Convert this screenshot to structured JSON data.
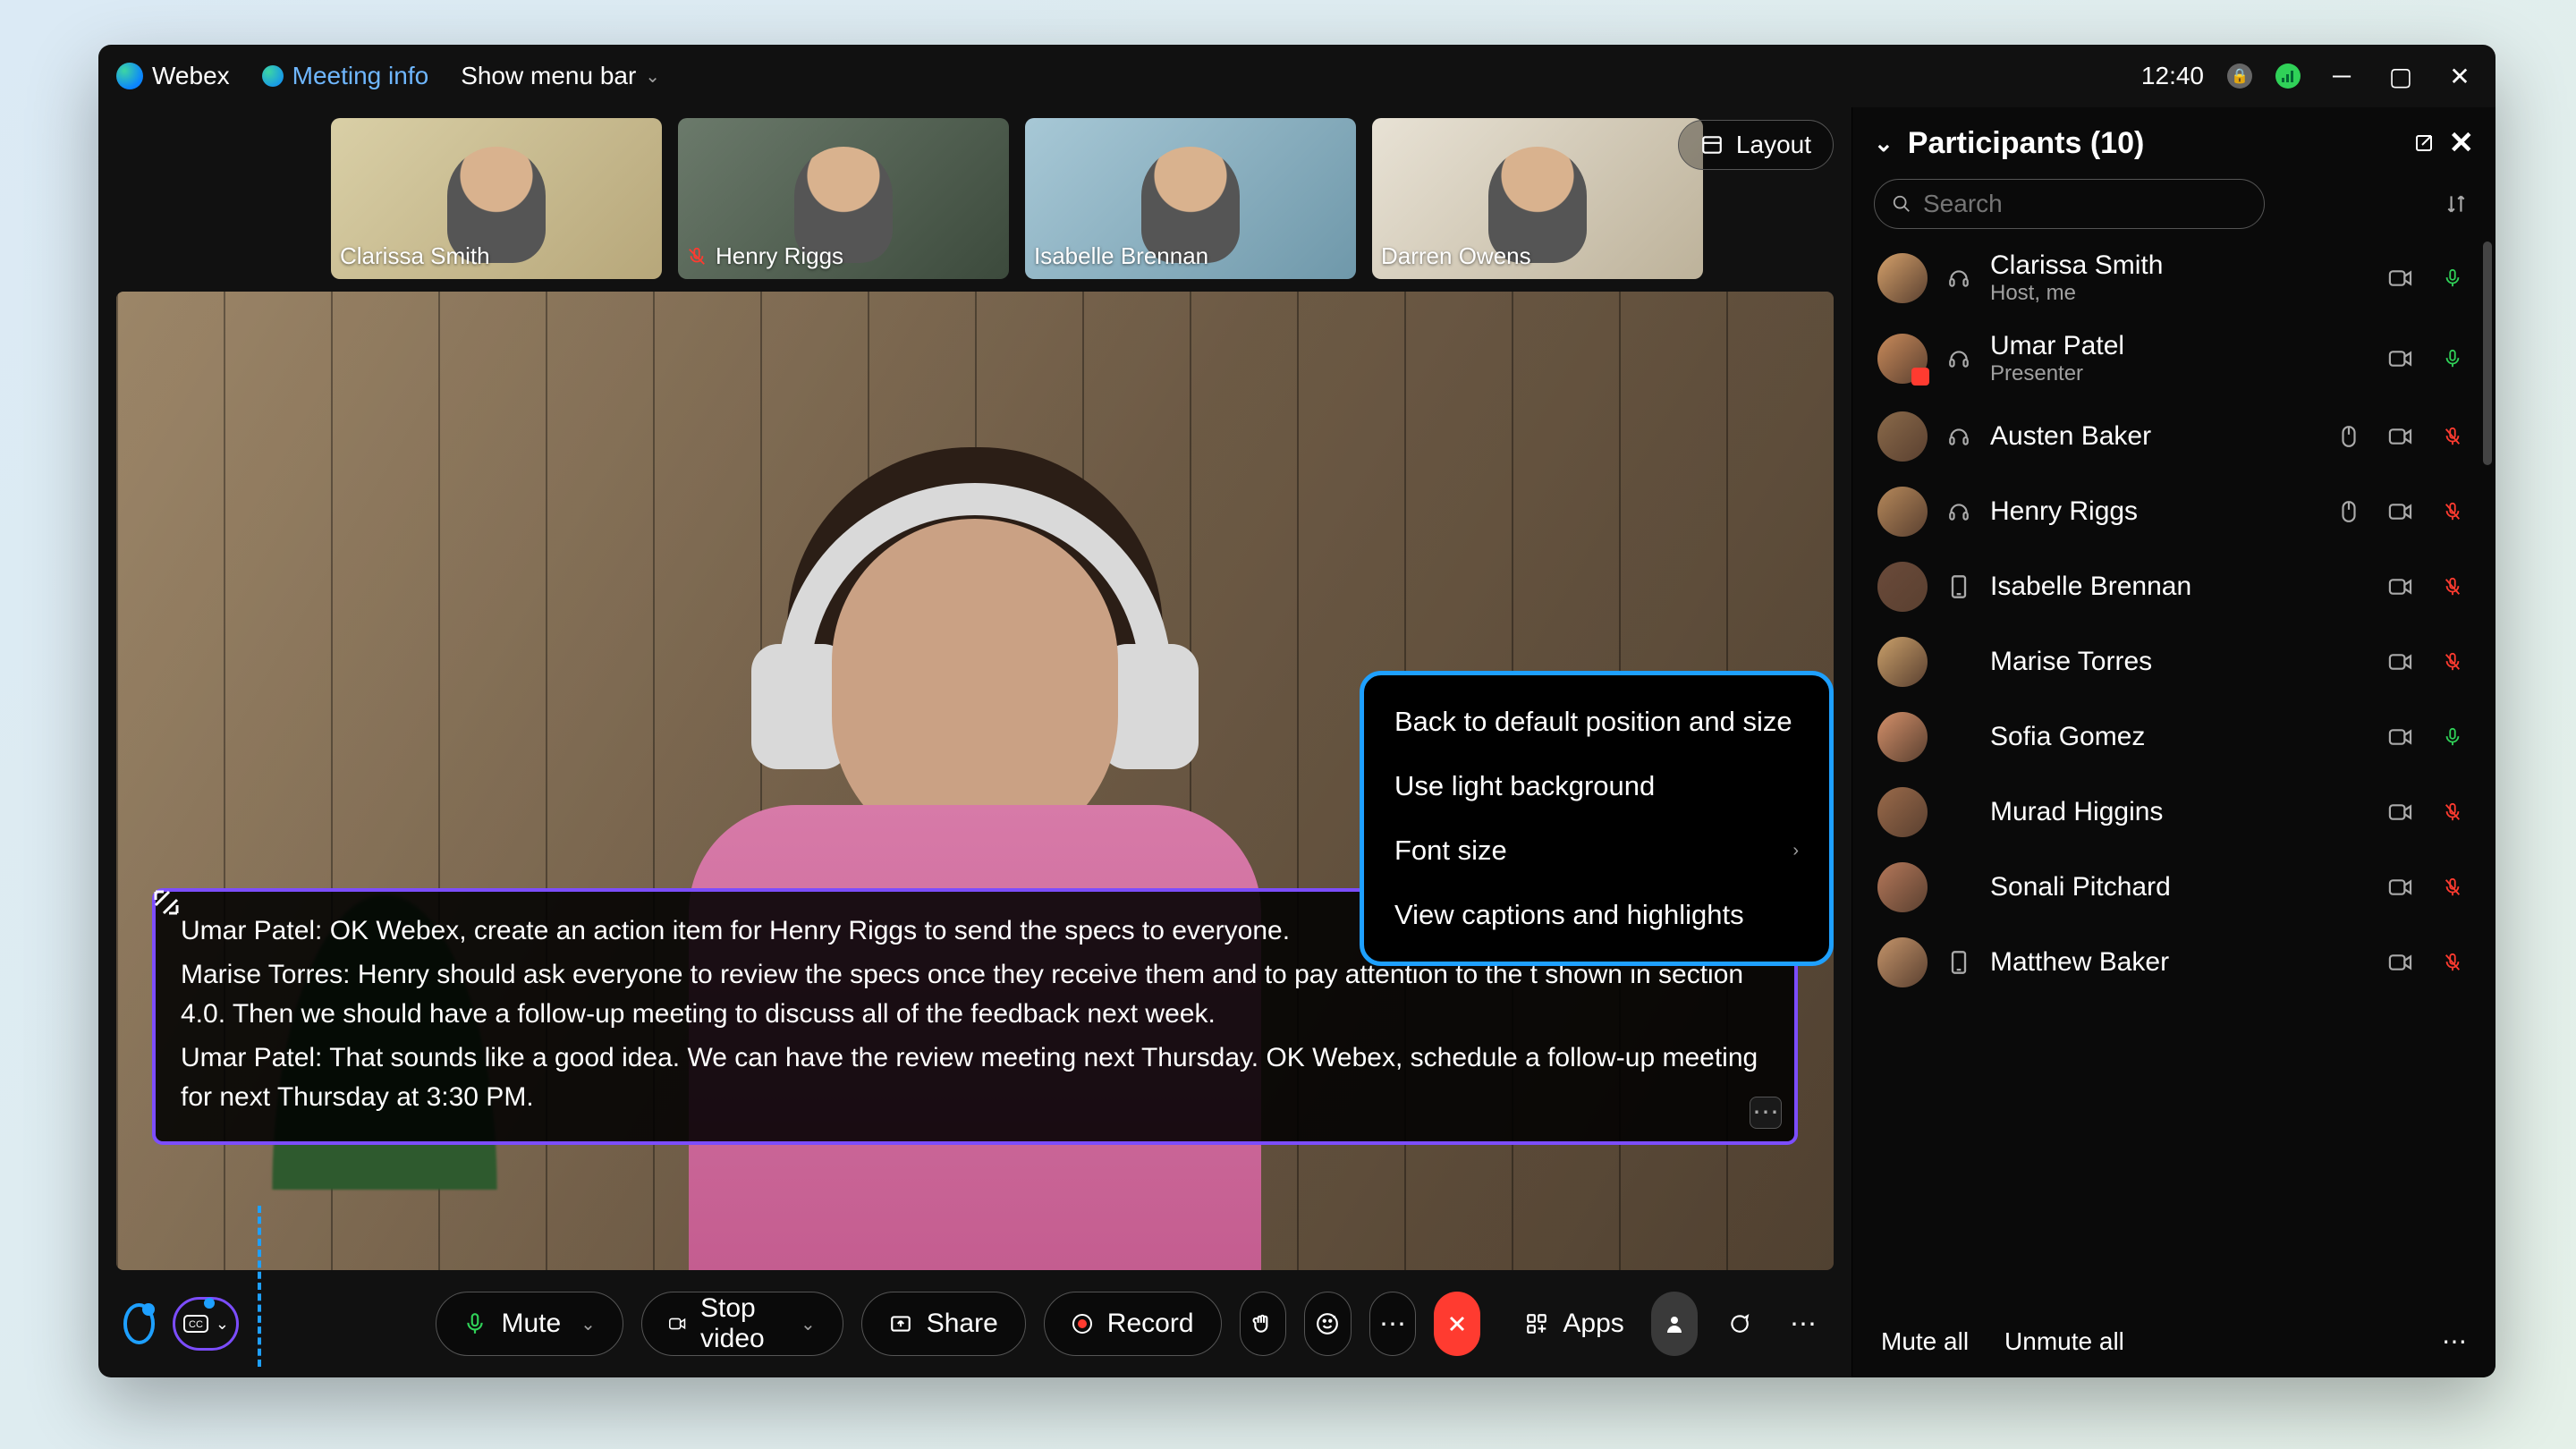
{
  "titlebar": {
    "app": "Webex",
    "meeting_info": "Meeting info",
    "menubar": "Show menu bar",
    "clock": "12:40"
  },
  "layout_btn": "Layout",
  "filmstrip": [
    {
      "name": "Clarissa Smith",
      "muted": false
    },
    {
      "name": "Henry Riggs",
      "muted": true
    },
    {
      "name": "Isabelle Brennan",
      "muted": false
    },
    {
      "name": "Darren Owens",
      "muted": false
    }
  ],
  "captions": [
    {
      "speaker": "Umar Patel",
      "text": "OK Webex, create an action item for Henry Riggs to send the specs to everyone."
    },
    {
      "speaker": "Marise Torres",
      "text": "Henry should ask everyone to review the specs once they receive them and to pay attention to the t shown in section 4.0. Then we should have a follow-up meeting to discuss all of the feedback next week."
    },
    {
      "speaker": "Umar Patel",
      "text": "That sounds like a good idea. We can have the review meeting next Thursday. OK Webex, schedule a follow-up meeting for next Thursday at 3:30 PM."
    }
  ],
  "caption_menu": {
    "back": "Back to default position and size",
    "light": "Use light background",
    "font": "Font size",
    "view": "View captions and highlights"
  },
  "toolbar": {
    "mute": "Mute",
    "stop_video": "Stop video",
    "share": "Share",
    "record": "Record",
    "apps": "Apps"
  },
  "participants": {
    "title": "Participants (10)",
    "search_placeholder": "Search",
    "mute_all": "Mute all",
    "unmute_all": "Unmute all",
    "items": [
      {
        "name": "Clarissa Smith",
        "role": "Host, me",
        "device": "headset",
        "mic": "on"
      },
      {
        "name": "Umar Patel",
        "role": "Presenter",
        "device": "headset",
        "mic": "on",
        "badge": true
      },
      {
        "name": "Austen Baker",
        "role": "",
        "device": "headset",
        "mic": "off",
        "mouse": true
      },
      {
        "name": "Henry Riggs",
        "role": "",
        "device": "headset",
        "mic": "off",
        "mouse": true
      },
      {
        "name": "Isabelle Brennan",
        "role": "",
        "device": "phone",
        "mic": "off"
      },
      {
        "name": "Marise Torres",
        "role": "",
        "device": "",
        "mic": "off"
      },
      {
        "name": "Sofia Gomez",
        "role": "",
        "device": "",
        "mic": "on"
      },
      {
        "name": "Murad Higgins",
        "role": "",
        "device": "",
        "mic": "off"
      },
      {
        "name": "Sonali Pitchard",
        "role": "",
        "device": "",
        "mic": "off"
      },
      {
        "name": "Matthew Baker",
        "role": "",
        "device": "phone",
        "mic": "off"
      }
    ]
  }
}
